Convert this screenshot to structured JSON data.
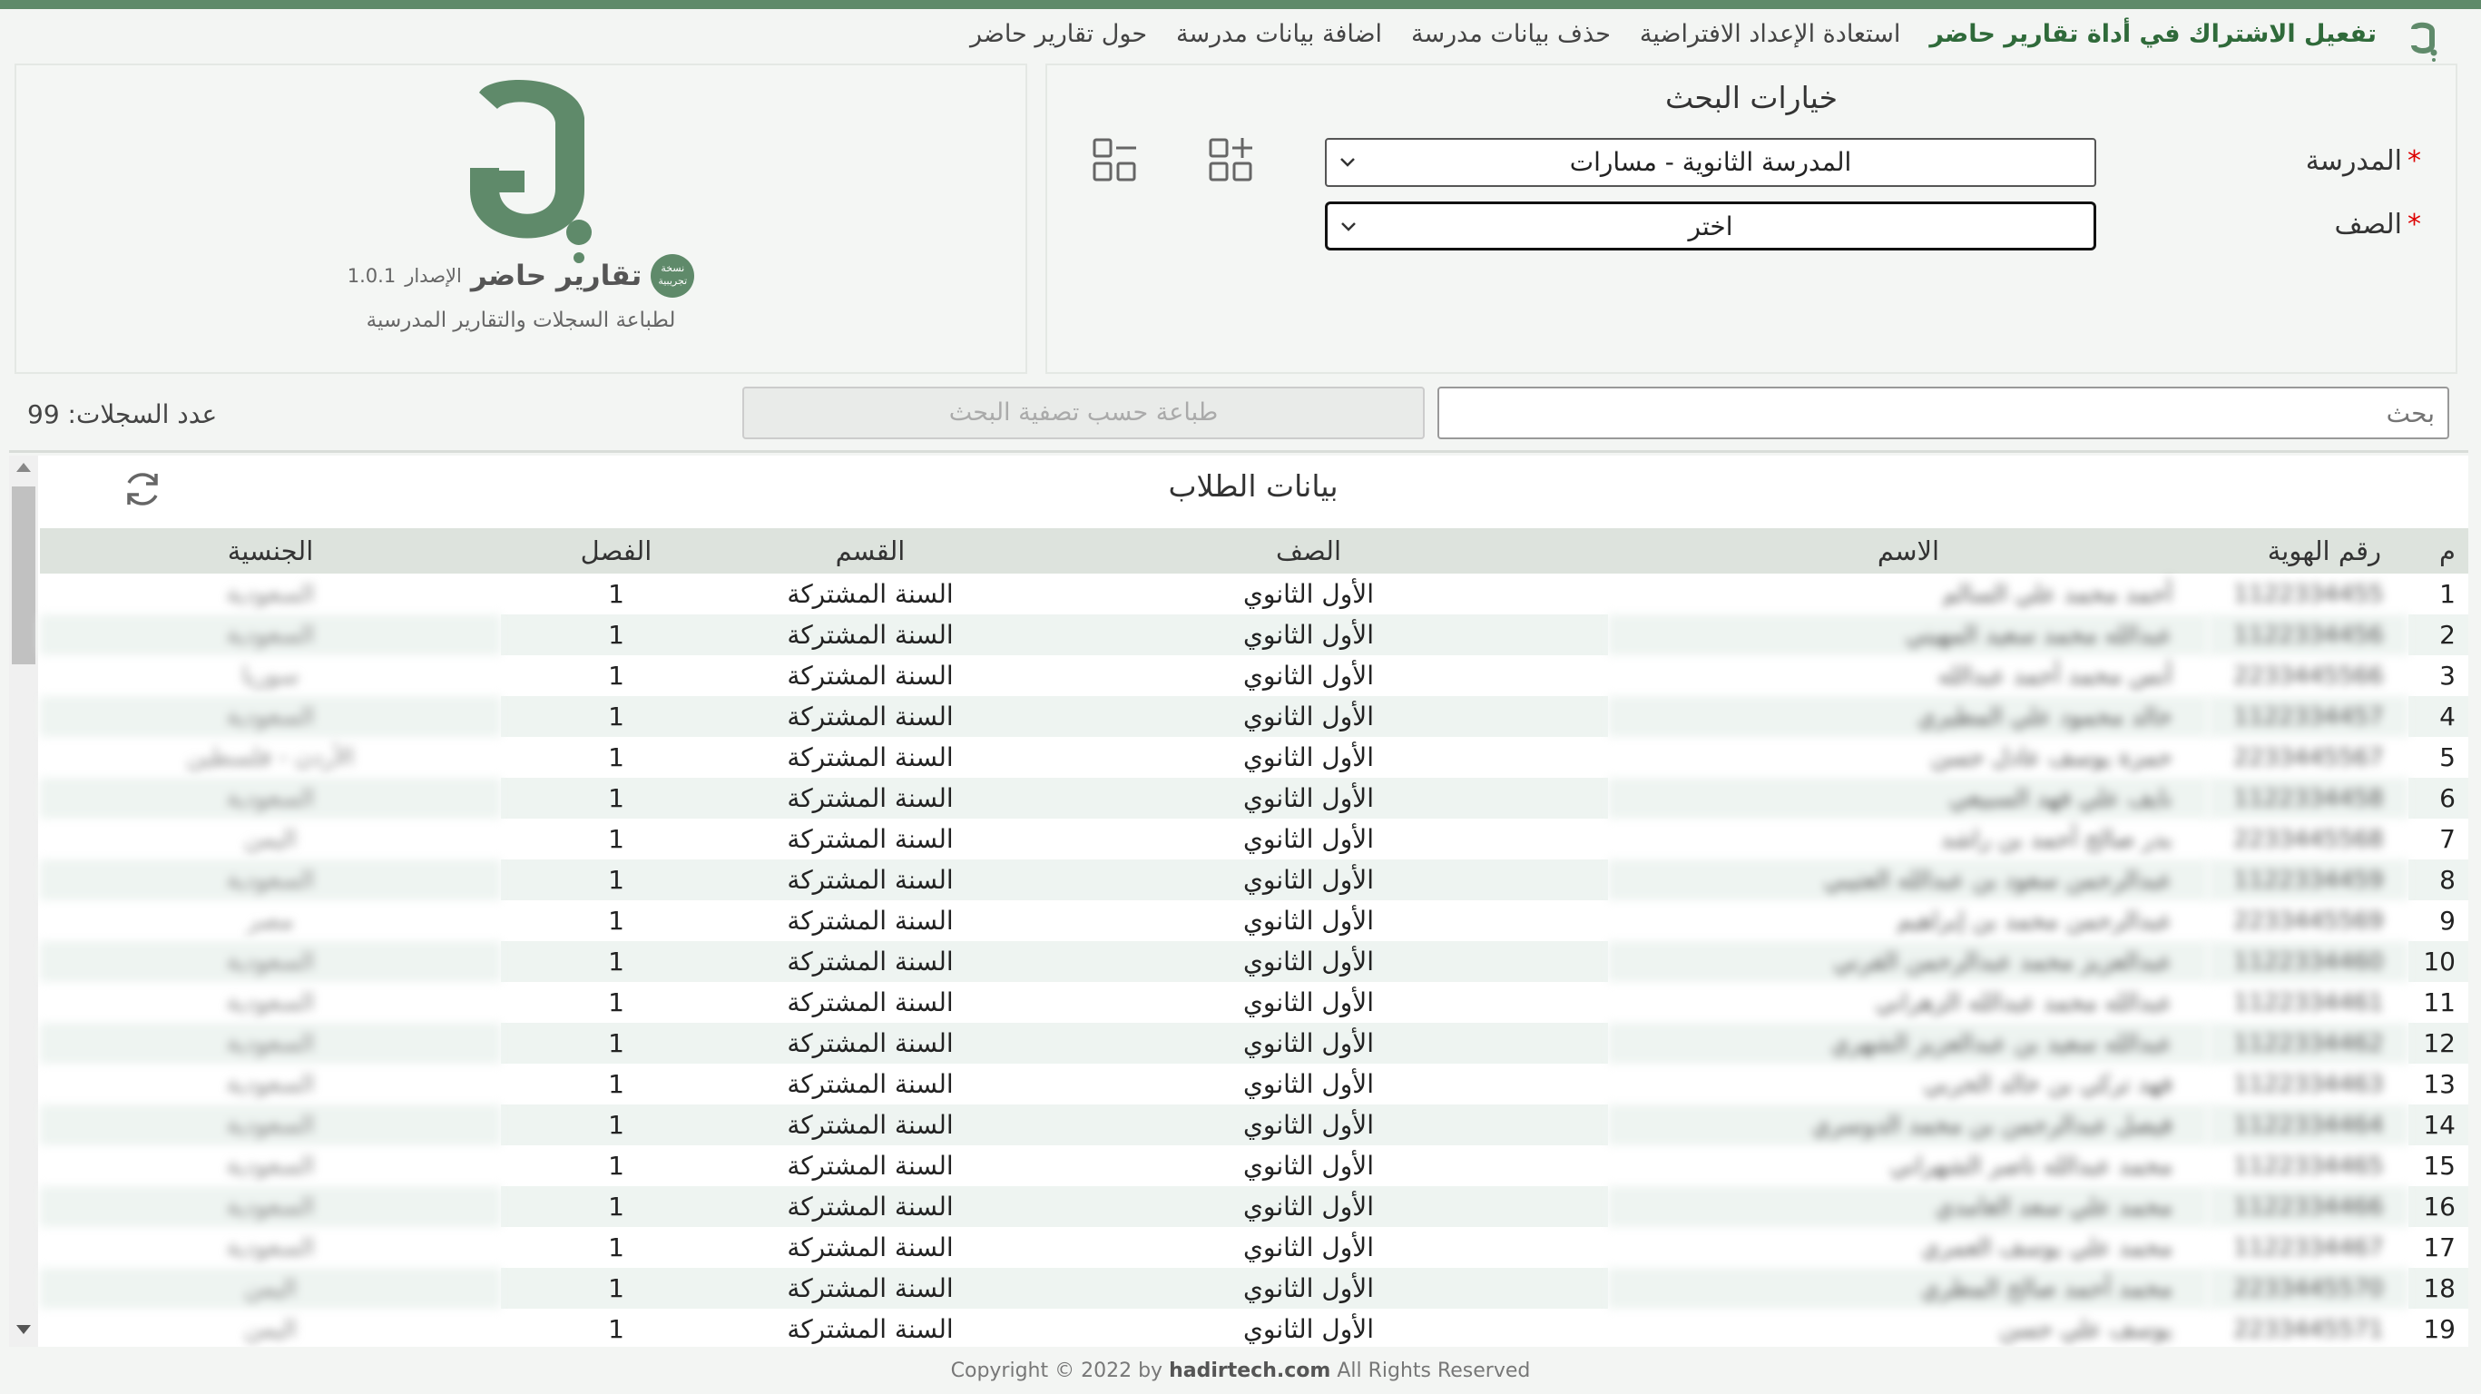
{
  "nav": {
    "links": [
      "حول تقارير حاضر",
      "اضافة بيانات مدرسة",
      "حذف بيانات مدرسة",
      "استعادة الإعداد الافتراضية",
      "تفعيل الاشتراك في أداة تقارير حاضر"
    ],
    "brand_color": "#5f8a6a"
  },
  "search": {
    "title": "خيارات البحث",
    "school_label": "المدرسة",
    "school_value": "المدرسة الثانوية - مسارات",
    "grade_label": "الصف",
    "grade_value": "اختر",
    "required_mark": "*"
  },
  "logo": {
    "badge": "نسخة تجريبية",
    "name": "تقارير حاضر",
    "version_label": "الإصدار",
    "version": "1.0.1",
    "subtitle": "لطباعة السجلات والتقارير المدرسية"
  },
  "filter": {
    "search_placeholder": "بحث",
    "print_label": "طباعة حسب تصفية البحث",
    "count_text": "عدد السجلات: 99"
  },
  "table": {
    "title": "بيانات الطلاب",
    "headers": [
      "م",
      "رقم الهوية",
      "الاسم",
      "الصف",
      "القسم",
      "الفصل",
      "الجنسية"
    ],
    "rows": [
      [
        "1",
        "1122334455",
        "أحمد محمد علي السالم",
        "الأول الثانوي",
        "السنة المشتركة",
        "1",
        "السعودية"
      ],
      [
        "2",
        "1122334456",
        "عبدالله محمد سعيد المهيني",
        "الأول الثانوي",
        "السنة المشتركة",
        "1",
        "السعودية"
      ],
      [
        "3",
        "2233445566",
        "أنس محمد أحمد عبدالله",
        "الأول الثانوي",
        "السنة المشتركة",
        "1",
        "سوريا"
      ],
      [
        "4",
        "1122334457",
        "خالد محمود علي المطيري",
        "الأول الثانوي",
        "السنة المشتركة",
        "1",
        "السعودية"
      ],
      [
        "5",
        "2233445567",
        "حمزة يوسف عادل حسن",
        "الأول الثانوي",
        "السنة المشتركة",
        "1",
        "الأردن - فلسطين"
      ],
      [
        "6",
        "1122334458",
        "نايف علي فهد السبيعي",
        "الأول الثانوي",
        "السنة المشتركة",
        "1",
        "السعودية"
      ],
      [
        "7",
        "2233445568",
        "بدر صالح أحمد بن راشد",
        "الأول الثانوي",
        "السنة المشتركة",
        "1",
        "اليمن"
      ],
      [
        "8",
        "1122334459",
        "عبدالرحمن سعود بن عبدالله العتيبي",
        "الأول الثانوي",
        "السنة المشتركة",
        "1",
        "السعودية"
      ],
      [
        "9",
        "2233445569",
        "عبدالرحمن محمد بن إبراهيم",
        "الأول الثانوي",
        "السنة المشتركة",
        "1",
        "مصر"
      ],
      [
        "10",
        "1122334460",
        "عبدالعزيز محمد عبدالرحمن القرني",
        "الأول الثانوي",
        "السنة المشتركة",
        "1",
        "السعودية"
      ],
      [
        "11",
        "1122334461",
        "عبدالله محمد عبدالله الزهراني",
        "الأول الثانوي",
        "السنة المشتركة",
        "1",
        "السعودية"
      ],
      [
        "12",
        "1122334462",
        "عبدالله سعيد بن عبدالعزيز الشهري",
        "الأول الثانوي",
        "السنة المشتركة",
        "1",
        "السعودية"
      ],
      [
        "13",
        "1122334463",
        "فهد تركي بن خالد الحربي",
        "الأول الثانوي",
        "السنة المشتركة",
        "1",
        "السعودية"
      ],
      [
        "14",
        "1122334464",
        "فيصل عبدالرحمن بن محمد الدوسري",
        "الأول الثانوي",
        "السنة المشتركة",
        "1",
        "السعودية"
      ],
      [
        "15",
        "1122334465",
        "محمد عبدالله ناصر الشهراني",
        "الأول الثانوي",
        "السنة المشتركة",
        "1",
        "السعودية"
      ],
      [
        "16",
        "1122334466",
        "محمد علي سعد الغامدي",
        "الأول الثانوي",
        "السنة المشتركة",
        "1",
        "السعودية"
      ],
      [
        "17",
        "1122334467",
        "محمد علي يوسف العمري",
        "الأول الثانوي",
        "السنة المشتركة",
        "1",
        "السعودية"
      ],
      [
        "18",
        "2233445570",
        "محمد أحمد صالح المطري",
        "الأول الثانوي",
        "السنة المشتركة",
        "1",
        "اليمن"
      ],
      [
        "19",
        "2233445571",
        "يوسف علي حسن",
        "الأول الثانوي",
        "السنة المشتركة",
        "1",
        "اليمن"
      ]
    ]
  },
  "footer": {
    "prefix": "Copyright © 2022 by",
    "site": "hadirtech.com",
    "suffix": "All Rights Reserved"
  }
}
